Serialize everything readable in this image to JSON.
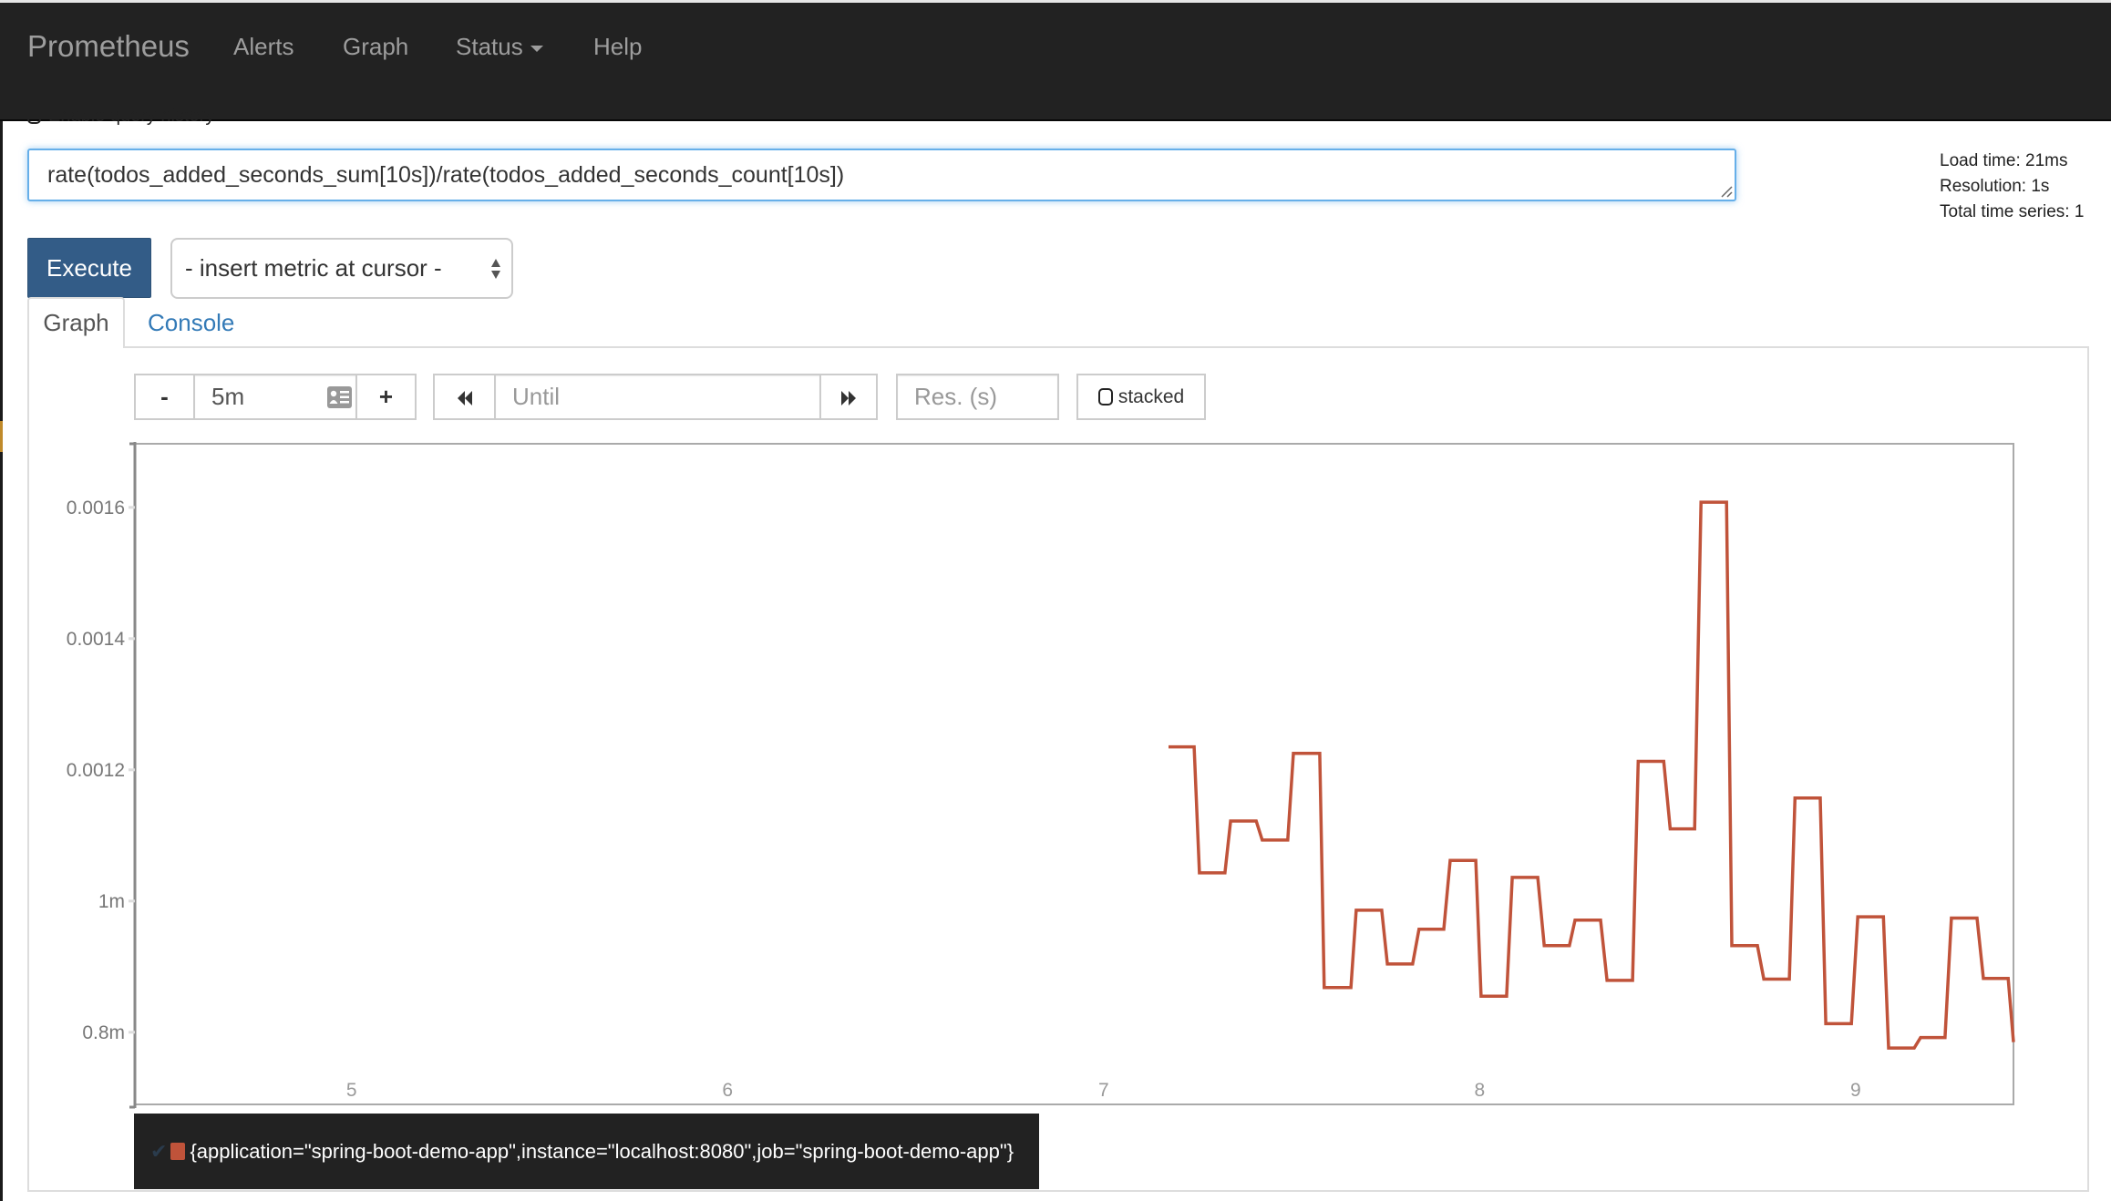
{
  "navbar": {
    "brand": "Prometheus",
    "items": [
      {
        "label": "Alerts"
      },
      {
        "label": "Graph"
      },
      {
        "label": "Status",
        "dropdown": true
      },
      {
        "label": "Help"
      }
    ]
  },
  "query_history": {
    "label": "Enable query history",
    "checked": false
  },
  "expression": {
    "value": "rate(todos_added_seconds_sum[10s])/rate(todos_added_seconds_count[10s])"
  },
  "execute_label": "Execute",
  "metric_select": {
    "selected": "- insert metric at cursor -"
  },
  "stats": {
    "load_time": "Load time: 21ms",
    "resolution": "Resolution: 1s",
    "total_series": "Total time series: 1"
  },
  "tabs": [
    {
      "label": "Graph",
      "active": true
    },
    {
      "label": "Console",
      "active": false
    }
  ],
  "controls": {
    "minus": "-",
    "range": "5m",
    "plus": "+",
    "until_placeholder": "Until",
    "resolution_placeholder": "Res. (s)",
    "stacked_label": "stacked",
    "stacked_checked": false,
    "icons": {
      "range_picker": "id-card-icon",
      "back": "backward-icon",
      "forward": "forward-icon"
    }
  },
  "legend": {
    "series_label": "{application=\"spring-boot-demo-app\",instance=\"localhost:8080\",job=\"spring-boot-demo-app\"}",
    "color": "#c0533a",
    "visible": true
  },
  "chart_data": {
    "type": "line",
    "title": "",
    "xlabel": "",
    "ylabel": "",
    "interpolation": "step",
    "grid": true,
    "xlim": [
      4.45,
      9.446
    ],
    "ylim": [
      0.00069,
      0.001697
    ],
    "xticks": [
      {
        "value": 5,
        "label": "5"
      },
      {
        "value": 6,
        "label": "6"
      },
      {
        "value": 7,
        "label": "7"
      },
      {
        "value": 8,
        "label": "8"
      },
      {
        "value": 9,
        "label": "9"
      }
    ],
    "yticks": [
      {
        "value": 0.0008,
        "label": "0.8m"
      },
      {
        "value": 0.001,
        "label": "1m"
      },
      {
        "value": 0.0012,
        "label": "0.0012"
      },
      {
        "value": 0.0014,
        "label": "0.0014"
      },
      {
        "value": 0.0016,
        "label": "0.0016"
      }
    ],
    "series": [
      {
        "name": "{application=\"spring-boot-demo-app\",instance=\"localhost:8080\",job=\"spring-boot-demo-app\"}",
        "color": "#c0533a",
        "points": [
          [
            7.199,
            0.001235
          ],
          [
            7.267,
            0.001235
          ],
          [
            7.281,
            0.001043
          ],
          [
            7.349,
            0.001043
          ],
          [
            7.364,
            0.001122
          ],
          [
            7.432,
            0.001122
          ],
          [
            7.448,
            0.001093
          ],
          [
            7.516,
            0.001093
          ],
          [
            7.531,
            0.001225
          ],
          [
            7.601,
            0.001225
          ],
          [
            7.613,
            0.000868
          ],
          [
            7.684,
            0.000868
          ],
          [
            7.698,
            0.000986
          ],
          [
            7.766,
            0.000986
          ],
          [
            7.781,
            0.000904
          ],
          [
            7.848,
            0.000904
          ],
          [
            7.865,
            0.000957
          ],
          [
            7.931,
            0.000957
          ],
          [
            7.948,
            0.001062
          ],
          [
            8.016,
            0.001062
          ],
          [
            8.03,
            0.000855
          ],
          [
            8.098,
            0.000855
          ],
          [
            8.113,
            0.001036
          ],
          [
            8.181,
            0.001036
          ],
          [
            8.198,
            0.000932
          ],
          [
            8.265,
            0.000932
          ],
          [
            8.28,
            0.000971
          ],
          [
            8.348,
            0.000971
          ],
          [
            8.365,
            0.000879
          ],
          [
            8.433,
            0.000879
          ],
          [
            8.448,
            0.001213
          ],
          [
            8.516,
            0.001213
          ],
          [
            8.533,
            0.00111
          ],
          [
            8.598,
            0.00111
          ],
          [
            8.615,
            0.001608
          ],
          [
            8.683,
            0.001608
          ],
          [
            8.697,
            0.000932
          ],
          [
            8.765,
            0.000932
          ],
          [
            8.782,
            0.000881
          ],
          [
            8.85,
            0.000881
          ],
          [
            8.865,
            0.001157
          ],
          [
            8.932,
            0.001157
          ],
          [
            8.947,
            0.000813
          ],
          [
            9.015,
            0.000813
          ],
          [
            9.032,
            0.000976
          ],
          [
            9.1,
            0.000976
          ],
          [
            9.114,
            0.000776
          ],
          [
            9.182,
            0.000776
          ],
          [
            9.199,
            0.000792
          ],
          [
            9.264,
            0.000792
          ],
          [
            9.281,
            0.000974
          ],
          [
            9.349,
            0.000974
          ],
          [
            9.366,
            0.000882
          ],
          [
            9.432,
            0.000882
          ],
          [
            9.446,
            0.000785
          ]
        ]
      }
    ]
  }
}
